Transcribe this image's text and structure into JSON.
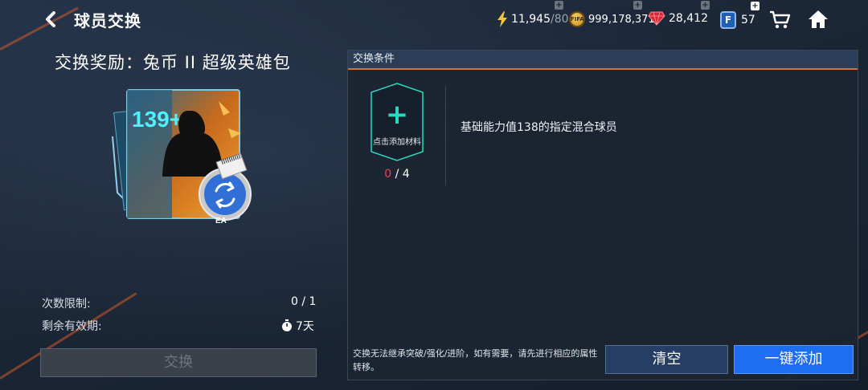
{
  "header": {
    "title": "球员交换"
  },
  "resources": {
    "energy": {
      "value": "11,945",
      "max": "/80"
    },
    "coins": {
      "value": "999,178,371",
      "coin_text": "FIFA"
    },
    "gems": {
      "value": "28,412"
    },
    "fc_points": {
      "value": "57",
      "badge_letter": "F"
    }
  },
  "reward": {
    "title": "交换奖励：兔币 II 超级英雄包",
    "pack_rating": "139+",
    "pack_brand": "EA"
  },
  "limits": {
    "count_label": "次数限制:",
    "count_value": "0 / 1",
    "validity_label": "剩余有效期:",
    "validity_value": "7天"
  },
  "exchange_button": "交换",
  "conditions": {
    "header": "交换条件",
    "slot_label": "点击添加材料",
    "slot_current": "0",
    "slot_total": " / 4",
    "requirement": "基础能力值138的指定混合球员",
    "notice": "交换无法继承突破/强化/进阶，如有需要，请先进行相应的属性转移。",
    "clear_button": "清空",
    "auto_add_button": "一键添加"
  },
  "colors": {
    "accent_teal": "#2ad8c2",
    "primary_blue": "#1e6ff0",
    "count_red": "#e0455a",
    "header_orange": "#c9773a"
  }
}
